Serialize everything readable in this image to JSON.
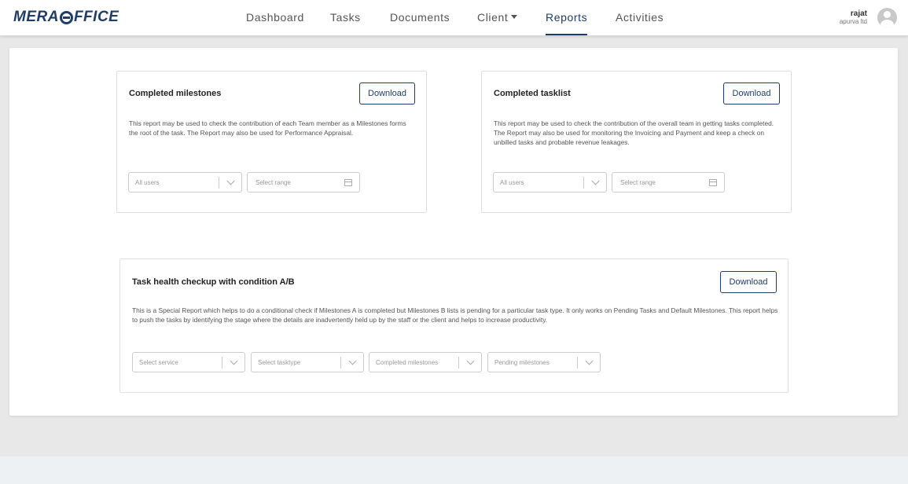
{
  "app": {
    "logo_part1": "MERA",
    "logo_part2": "FFICE"
  },
  "nav": {
    "items": [
      {
        "label": "Dashboard"
      },
      {
        "label": "Tasks"
      },
      {
        "label": "Documents"
      },
      {
        "label": "Client"
      },
      {
        "label": "Reports"
      },
      {
        "label": "Activities"
      }
    ],
    "active": "Reports"
  },
  "user": {
    "name": "rajat",
    "org": "apurva ltd"
  },
  "cards": [
    {
      "title": "Completed milestones",
      "download_label": "Download",
      "description": "This report may be used to check the contribution of each Team member as a Milestones forms the root of the task. The Report may also be used for Performance Appraisal.",
      "filters": [
        "All users",
        "Select range"
      ]
    },
    {
      "title": "Completed tasklist",
      "download_label": "Download",
      "description": "This report may be used to check the contribution of the overall team in getting tasks completed. The Report may also be used for monitoring the Invoicing and Payment and keep a check on unbilled tasks and probable revenue leakages.",
      "filters": [
        "All users",
        "Select range"
      ]
    },
    {
      "title": "Task health checkup with condition A/B",
      "download_label": "Download",
      "description": "This is a Special Report which helps to do a conditional check if Milestones A is completed but Milestones B lists is pending for a particular task type. It only works on Pending Tasks and Default Milestones. This report helps to push the tasks by identifying the stage where the details are inadvertently held up by the staff or the client and helps to increase productivity.",
      "filters": [
        "Select service",
        "Select tasktype",
        "Completed milestones",
        "Pending milestones"
      ]
    }
  ],
  "colors": {
    "brand": "#1f3d66",
    "background": "#e8e8e8",
    "footer": "#eef1f3"
  }
}
